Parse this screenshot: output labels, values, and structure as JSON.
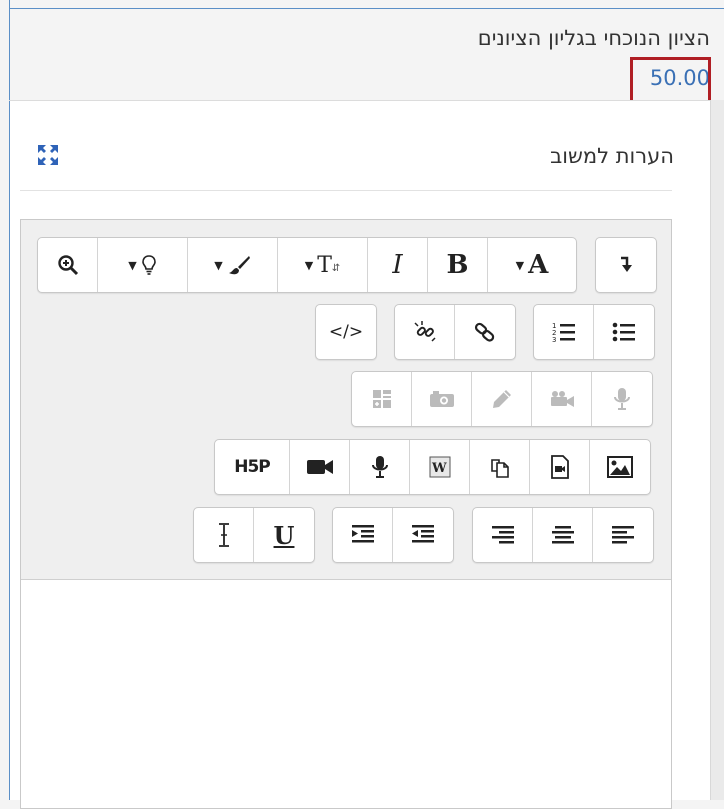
{
  "grade": {
    "label": "הציון הנוכחי בגליון הציונים",
    "value": "50.00"
  },
  "feedback": {
    "label": "הערות למשוב"
  },
  "toolbar": {
    "bold": "B",
    "italic": "I",
    "font_color": "A",
    "font_size": "T",
    "underline": "U",
    "h5p": "H5P",
    "code": "</>"
  },
  "colors": {
    "accent": "#3a70b5",
    "highlight_border": "#b01e24"
  }
}
